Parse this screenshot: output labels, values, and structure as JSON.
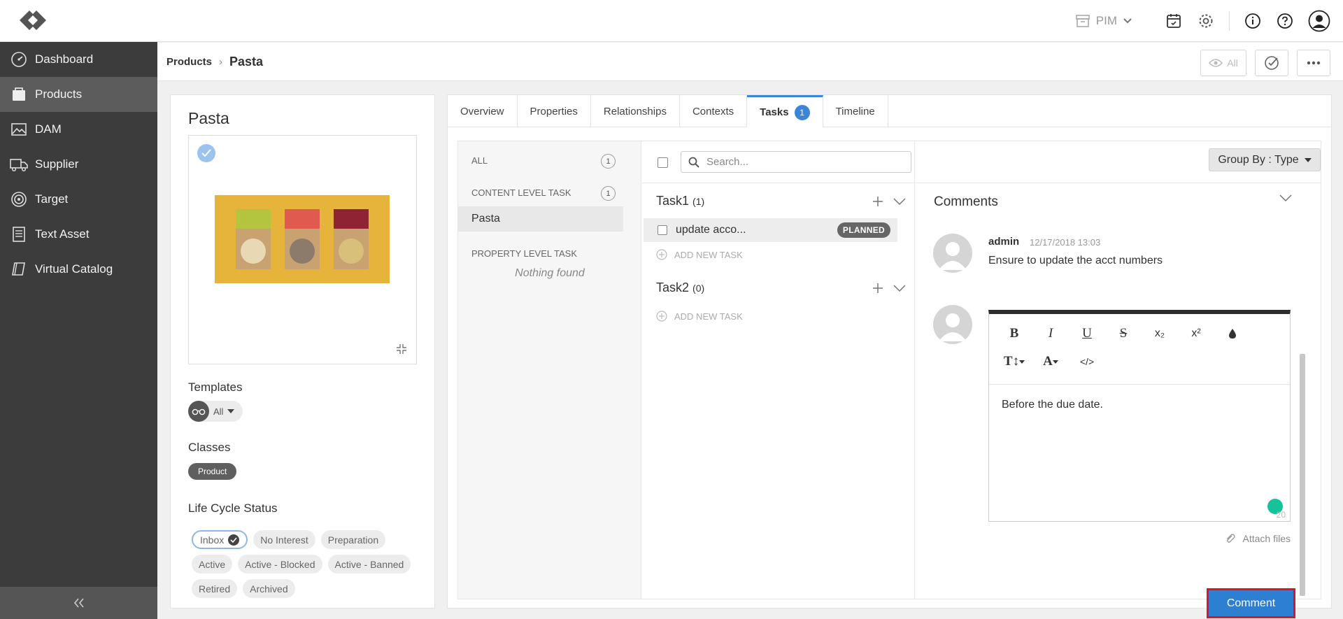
{
  "topbar": {
    "module_label": "PIM",
    "icons": [
      "logo-icon",
      "archive-icon",
      "calendar-icon",
      "gear-icon",
      "info-icon",
      "help-icon",
      "user-icon"
    ]
  },
  "sidebar": {
    "items": [
      {
        "label": "Dashboard",
        "icon": "dashboard-icon"
      },
      {
        "label": "Products",
        "icon": "products-icon",
        "active": true
      },
      {
        "label": "DAM",
        "icon": "image-icon"
      },
      {
        "label": "Supplier",
        "icon": "truck-icon"
      },
      {
        "label": "Target",
        "icon": "target-icon"
      },
      {
        "label": "Text Asset",
        "icon": "document-icon"
      },
      {
        "label": "Virtual Catalog",
        "icon": "book-icon"
      }
    ]
  },
  "breadcrumb": {
    "parent": "Products",
    "separator": "›",
    "current": "Pasta",
    "view_all_label": "All"
  },
  "product": {
    "title": "Pasta",
    "templates_label": "Templates",
    "template_value": "All",
    "classes_label": "Classes",
    "class_value": "Product",
    "lifecycle_label": "Life Cycle Status",
    "lifecycle": [
      "Inbox",
      "No Interest",
      "Preparation",
      "Active",
      "Active - Blocked",
      "Active - Banned",
      "Retired",
      "Archived"
    ],
    "lifecycle_selected": "Inbox"
  },
  "tabs": [
    {
      "label": "Overview"
    },
    {
      "label": "Properties"
    },
    {
      "label": "Relationships"
    },
    {
      "label": "Contexts"
    },
    {
      "label": "Tasks",
      "count": "1",
      "active": true
    },
    {
      "label": "Timeline"
    }
  ],
  "categories": {
    "all_label": "ALL",
    "all_count": "1",
    "content_label": "CONTENT LEVEL TASK",
    "content_count": "1",
    "content_item": "Pasta",
    "property_label": "PROPERTY LEVEL TASK",
    "property_empty": "Nothing found"
  },
  "task_list": {
    "search_placeholder": "Search...",
    "group_by": "Group By : Type",
    "groups": [
      {
        "title": "Task1",
        "count": "(1)"
      },
      {
        "title": "Task2",
        "count": "(0)"
      }
    ],
    "task": {
      "title": "update acco...",
      "status": "PLANNED"
    },
    "add_new": "ADD NEW TASK"
  },
  "comments": {
    "title": "Comments",
    "author": "admin",
    "timestamp": "12/17/2018 13:03",
    "text": "Ensure to update the acct numbers",
    "editor_text": "Before the due date.",
    "char_count": "20",
    "toolbar": [
      "B",
      "I",
      "U",
      "S",
      "x₂",
      "x²",
      "💧",
      "T↕",
      "A",
      "</>"
    ],
    "attach_label": "Attach files",
    "submit_label": "Comment"
  }
}
